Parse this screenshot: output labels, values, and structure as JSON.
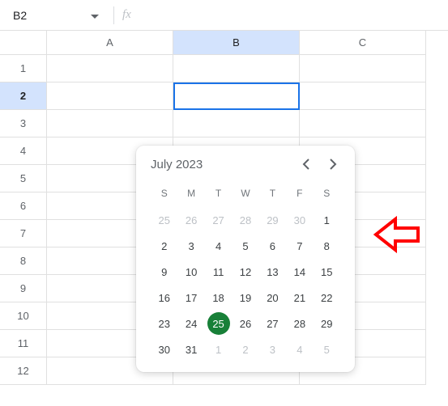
{
  "cell_ref": "B2",
  "fx_symbol": "fx",
  "columns": [
    "A",
    "B",
    "C"
  ],
  "columns_selected": [
    false,
    true,
    false
  ],
  "rows": [
    "1",
    "2",
    "3",
    "4",
    "5",
    "6",
    "7",
    "8",
    "9",
    "10",
    "11",
    "12"
  ],
  "row_selected": "2",
  "active_cell": {
    "row": 1,
    "col": 1
  },
  "date_picker": {
    "title": "July 2023",
    "dow": [
      "S",
      "M",
      "T",
      "W",
      "T",
      "F",
      "S"
    ],
    "weeks": [
      [
        {
          "d": "25",
          "o": true
        },
        {
          "d": "26",
          "o": true
        },
        {
          "d": "27",
          "o": true
        },
        {
          "d": "28",
          "o": true
        },
        {
          "d": "29",
          "o": true
        },
        {
          "d": "30",
          "o": true
        },
        {
          "d": "1"
        }
      ],
      [
        {
          "d": "2"
        },
        {
          "d": "3"
        },
        {
          "d": "4"
        },
        {
          "d": "5"
        },
        {
          "d": "6"
        },
        {
          "d": "7"
        },
        {
          "d": "8"
        }
      ],
      [
        {
          "d": "9"
        },
        {
          "d": "10"
        },
        {
          "d": "11"
        },
        {
          "d": "12"
        },
        {
          "d": "13"
        },
        {
          "d": "14"
        },
        {
          "d": "15"
        }
      ],
      [
        {
          "d": "16"
        },
        {
          "d": "17"
        },
        {
          "d": "18"
        },
        {
          "d": "19"
        },
        {
          "d": "20"
        },
        {
          "d": "21"
        },
        {
          "d": "22"
        }
      ],
      [
        {
          "d": "23"
        },
        {
          "d": "24"
        },
        {
          "d": "25",
          "today": true
        },
        {
          "d": "26"
        },
        {
          "d": "27"
        },
        {
          "d": "28"
        },
        {
          "d": "29"
        }
      ],
      [
        {
          "d": "30"
        },
        {
          "d": "31"
        },
        {
          "d": "1",
          "o": true
        },
        {
          "d": "2",
          "o": true
        },
        {
          "d": "3",
          "o": true
        },
        {
          "d": "4",
          "o": true
        },
        {
          "d": "5",
          "o": true
        }
      ]
    ]
  }
}
